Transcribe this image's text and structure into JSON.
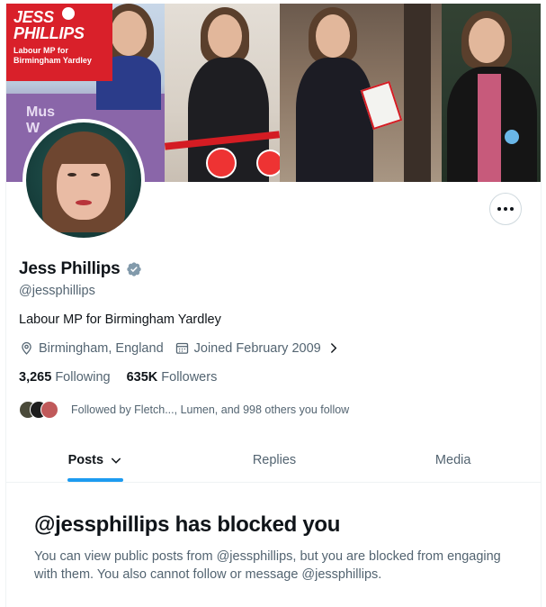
{
  "banner": {
    "brand_name_line1": "JESS",
    "brand_name_line2": "PHILLIPS",
    "brand_subtitle": "Labour MP for Birmingham Yardley",
    "purple_sign_text": "Mus\nW",
    "colors": {
      "labour_red": "#d9202a",
      "purple": "#8a66a9"
    }
  },
  "profile": {
    "display_name": "Jess Phillips",
    "verified_icon": "verified-badge-icon",
    "handle": "@jessphillips",
    "bio": "Labour MP for Birmingham Yardley",
    "location": "Birmingham, England",
    "joined": "Joined February 2009",
    "following_count": "3,265",
    "following_label": "Following",
    "followers_count": "635K",
    "followers_label": "Followers",
    "followed_by": "Followed by Fletch..., Lumen, and 998 others you follow"
  },
  "tabs": [
    {
      "label": "Posts",
      "active": true
    },
    {
      "label": "Replies",
      "active": false
    },
    {
      "label": "Media",
      "active": false
    }
  ],
  "blocked": {
    "title": "@jessphillips has blocked you",
    "body": "You can view public posts from @jessphillips, but you are blocked from engaging with them. You also cannot follow or message @jessphillips."
  },
  "colors": {
    "accent": "#1d9bf0",
    "text_primary": "#0f1419",
    "text_secondary": "#536471",
    "verified": "#829aab"
  }
}
